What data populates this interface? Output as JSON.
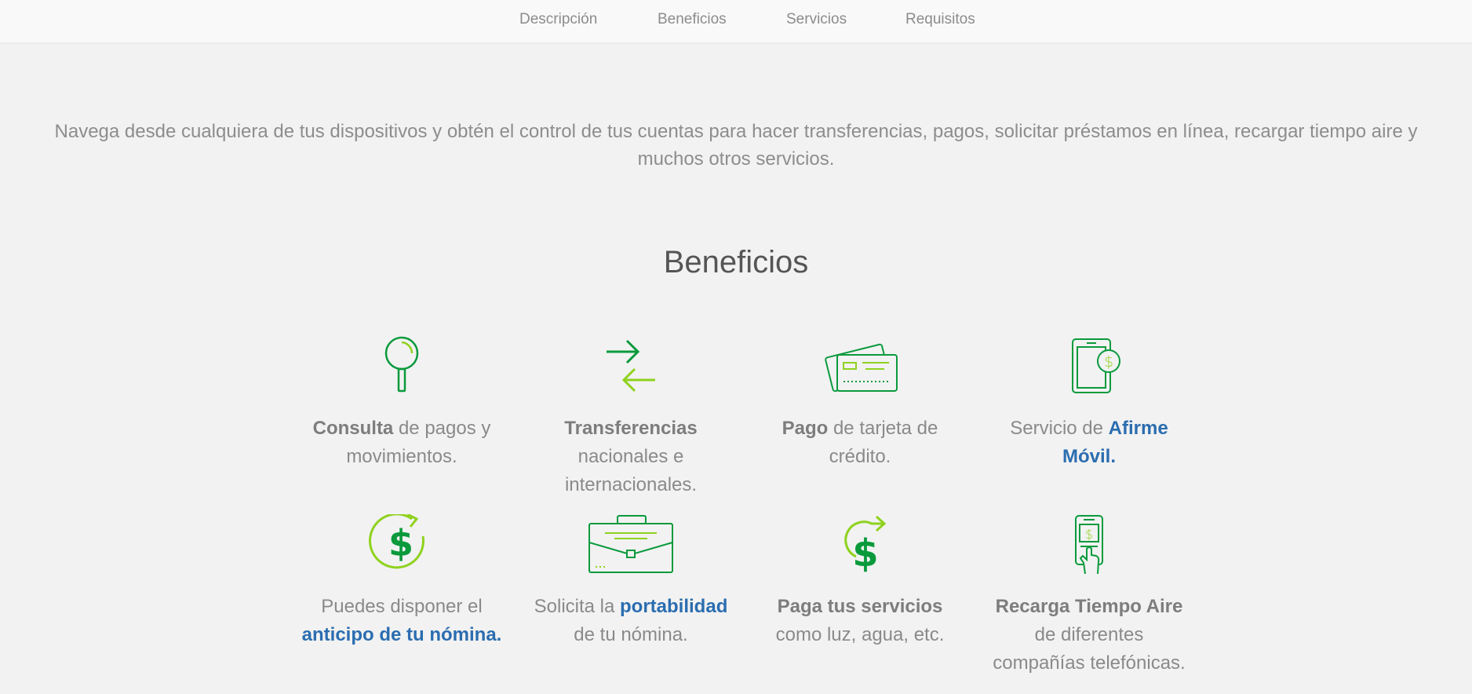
{
  "nav": {
    "items": [
      "Descripción",
      "Beneficios",
      "Servicios",
      "Requisitos"
    ]
  },
  "intro": "Navega desde cualquiera de tus dispositivos y obtén el control de tus cuentas para hacer transferencias, pagos, solicitar préstamos en línea, recargar tiempo aire y muchos otros servicios.",
  "section_title": "Beneficios",
  "colors": {
    "accent_dark": "#0a9a3c",
    "accent_light": "#8fd21e",
    "link_blue": "#2b6db0"
  },
  "benefits": [
    {
      "icon": "magnifier-icon",
      "parts": [
        {
          "t": "Consulta",
          "s": "bold"
        },
        {
          "t": " de pagos y movimientos.",
          "s": "normal"
        }
      ]
    },
    {
      "icon": "transfer-arrows-icon",
      "parts": [
        {
          "t": "Transferencias",
          "s": "bold"
        },
        {
          "t": " nacionales e internacionales.",
          "s": "normal"
        }
      ]
    },
    {
      "icon": "credit-cards-icon",
      "parts": [
        {
          "t": "Pago",
          "s": "bold"
        },
        {
          "t": " de tarjeta de crédito.",
          "s": "normal"
        }
      ]
    },
    {
      "icon": "mobile-dollar-icon",
      "parts": [
        {
          "t": "Servicio de ",
          "s": "normal"
        },
        {
          "t": "Afirme Móvil.",
          "s": "blue"
        }
      ]
    },
    {
      "icon": "dollar-cycle-icon",
      "parts": [
        {
          "t": "Puedes disponer el ",
          "s": "normal"
        },
        {
          "t": "anticipo de tu nómina.",
          "s": "blue"
        }
      ]
    },
    {
      "icon": "briefcase-icon",
      "parts": [
        {
          "t": "Solicita la ",
          "s": "normal"
        },
        {
          "t": "portabilidad",
          "s": "blue"
        },
        {
          "t": " de tu nómina.",
          "s": "normal"
        }
      ]
    },
    {
      "icon": "dollar-arrow-icon",
      "parts": [
        {
          "t": "Paga tus servicios",
          "s": "bold"
        },
        {
          "t": " como luz, agua, etc.",
          "s": "normal"
        }
      ]
    },
    {
      "icon": "phone-tap-icon",
      "parts": [
        {
          "t": "Recarga Tiempo Aire",
          "s": "bold"
        },
        {
          "t": " de diferentes compañías telefónicas.",
          "s": "normal"
        }
      ]
    }
  ]
}
